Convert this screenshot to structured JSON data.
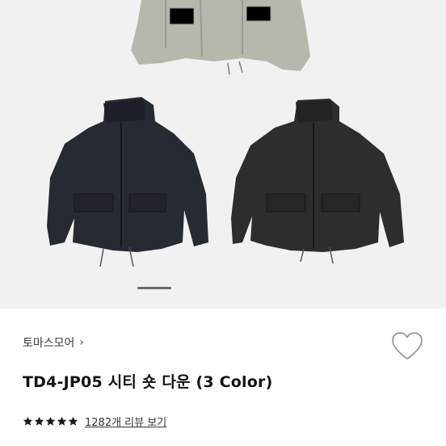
{
  "product": {
    "brand_label": "토마스모어",
    "brand_chevron": "›",
    "title": "TD4-JP05 시티 숏 다운 (3 Color)",
    "rating_stars": 5,
    "review_link": "1282개 리뷰 보기"
  },
  "gallery": {
    "active_slide": 1,
    "jacket_colors": [
      "#b4b6ad",
      "#262a33",
      "#2c2d2c"
    ]
  },
  "colors": {
    "star": "#1a1a1a",
    "heart_stroke": "#999999"
  }
}
